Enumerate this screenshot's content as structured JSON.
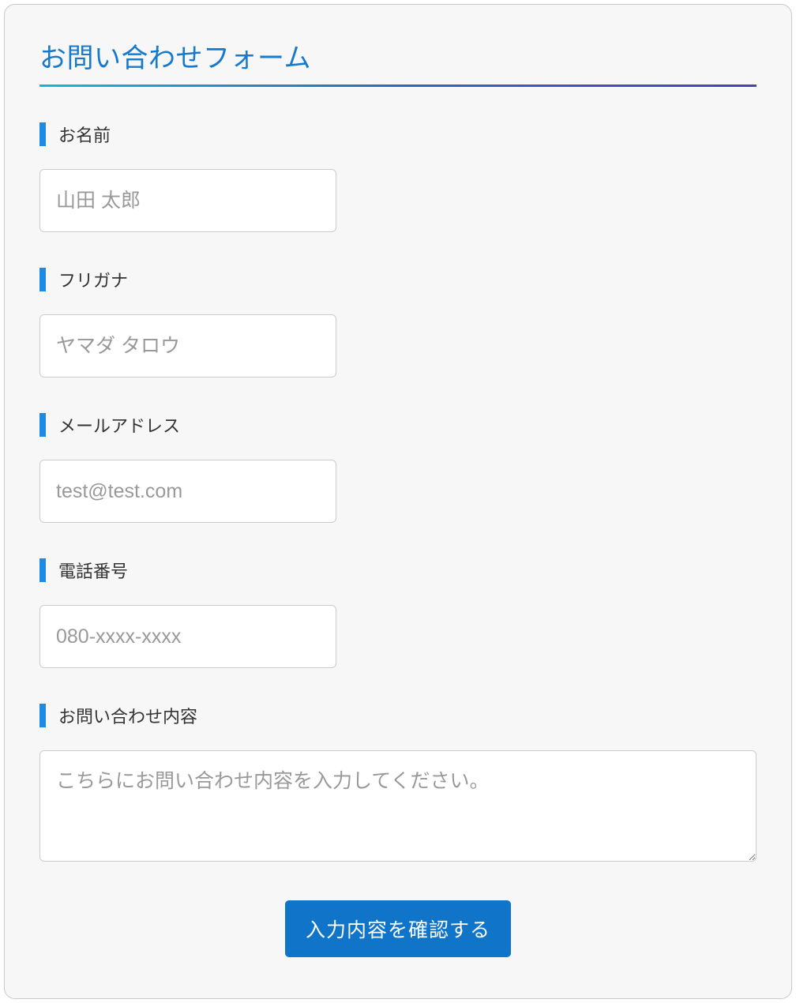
{
  "form": {
    "title": "お問い合わせフォーム",
    "fields": {
      "name": {
        "label": "お名前",
        "placeholder": "山田 太郎",
        "value": ""
      },
      "furigana": {
        "label": "フリガナ",
        "placeholder": "ヤマダ タロウ",
        "value": ""
      },
      "email": {
        "label": "メールアドレス",
        "placeholder": "test@test.com",
        "value": ""
      },
      "phone": {
        "label": "電話番号",
        "placeholder": "080-xxxx-xxxx",
        "value": ""
      },
      "message": {
        "label": "お問い合わせ内容",
        "placeholder": "こちらにお問い合わせ内容を入力してください。",
        "value": ""
      }
    },
    "submit_label": "入力内容を確認する"
  }
}
